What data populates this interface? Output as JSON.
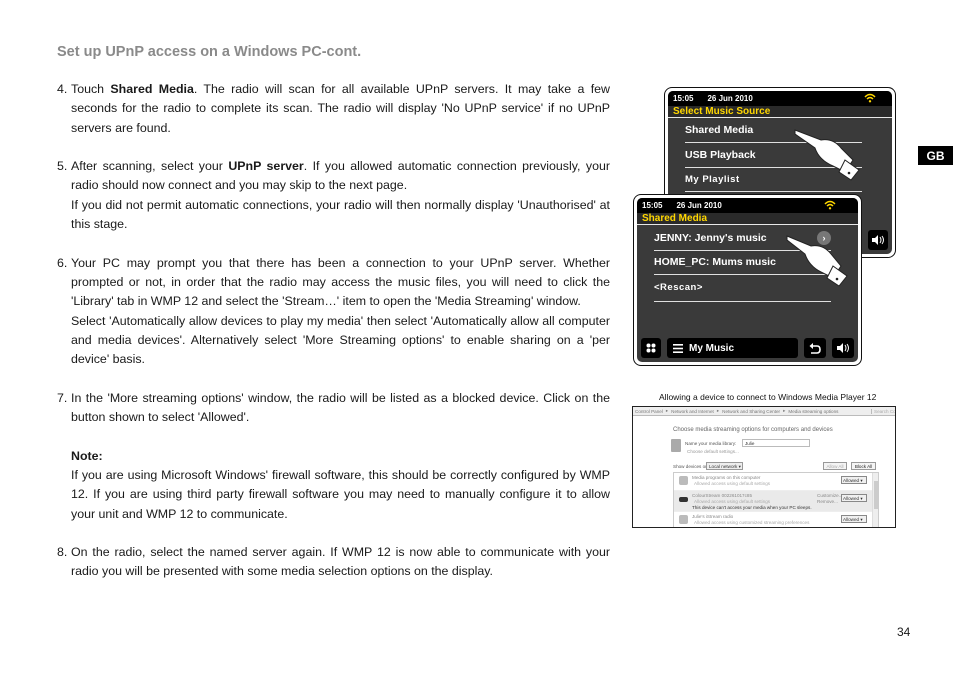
{
  "page": {
    "title": "Set up UPnP access on a Windows PC-cont.",
    "language_badge": "GB",
    "page_number": "34"
  },
  "steps": {
    "s4": {
      "num": "4.",
      "pre": "Touch ",
      "bold": "Shared Media",
      "post": ". The radio will scan for all available UPnP servers. It may take a few seconds for the radio to complete its scan. The radio will display 'No UPnP service' if no UPnP servers are found."
    },
    "s5": {
      "num": "5.",
      "pre": "After scanning, select your ",
      "bold": "UPnP server",
      "post": ". If you allowed automatic connection previously, your radio should now connect and you may skip to the next page.",
      "extra": "If you did not permit automatic connections, your radio will then normally display 'Unauthorised' at this stage."
    },
    "s6": {
      "num": "6.",
      "text": "Your PC may prompt you that there has been a connection to your UPnP server. Whether prompted or not, in order that the radio may access the music files, you will need to click the 'Library' tab in WMP 12 and select the 'Stream…' item to open the 'Media Streaming' window.",
      "extra": "Select 'Automatically allow devices to play my media' then select 'Automatically allow all computer and media devices'. Alternatively select 'More Streaming options' to enable sharing on a 'per device' basis."
    },
    "s7": {
      "num": "7.",
      "text": "In the 'More streaming options' window, the radio will be listed as a blocked device. Click on the button shown to select 'Allowed'.",
      "note_label": "Note:",
      "note": "If you are using Microsoft Windows' firewall software, this should be correctly configured by WMP 12. If you are using third party firewall software you may need to manually configure it to allow your unit and WMP 12 to communicate."
    },
    "s8": {
      "num": "8.",
      "text": "On the radio, select the named server again. If WMP 12 is now able to communicate with your radio you will be presented with some media selection options on the display."
    }
  },
  "radio_back": {
    "time": "15:05",
    "date": "26 Jun 2010",
    "title": "Select Music Source",
    "items": [
      "Shared Media",
      "USB Playback",
      "My Playlist"
    ]
  },
  "radio_front": {
    "time": "15:05",
    "date": "26 Jun 2010",
    "title": "Shared Media",
    "items": [
      "JENNY: Jenny's music",
      "HOME_PC: Mums music",
      "<Rescan>"
    ],
    "bottom_label": "My Music"
  },
  "wmp": {
    "caption": "Allowing a device to connect to Windows Media Player 12",
    "breadcrumb": [
      "Control Panel",
      "Network and Internet",
      "Network and Sharing Center",
      "Media streaming options"
    ],
    "search_placeholder": "Search Con",
    "heading": "Choose media streaming options for computers and devices",
    "name_label": "Name your media library:",
    "name_value": "Julie",
    "defaults_link": "Choose default settings...",
    "show_label": "Show devices on:",
    "show_value": "Local network",
    "allow_all": "Allow All",
    "block_all": "Block All",
    "devices": [
      {
        "name": "Media programs on this computer",
        "desc": "Allowed access using default settings",
        "status": "Allowed"
      },
      {
        "name": "ColourStream 002261017c85",
        "desc": "Allowed access using default settings",
        "warning": "This device can't access your media when your PC sleeps.",
        "customize": "Customize...",
        "remove": "Remove...",
        "status": "Allowed"
      },
      {
        "name": "Julie's iStream radio",
        "desc": "Allowed access using customized streaming preferences",
        "status": "Allowed"
      }
    ]
  }
}
